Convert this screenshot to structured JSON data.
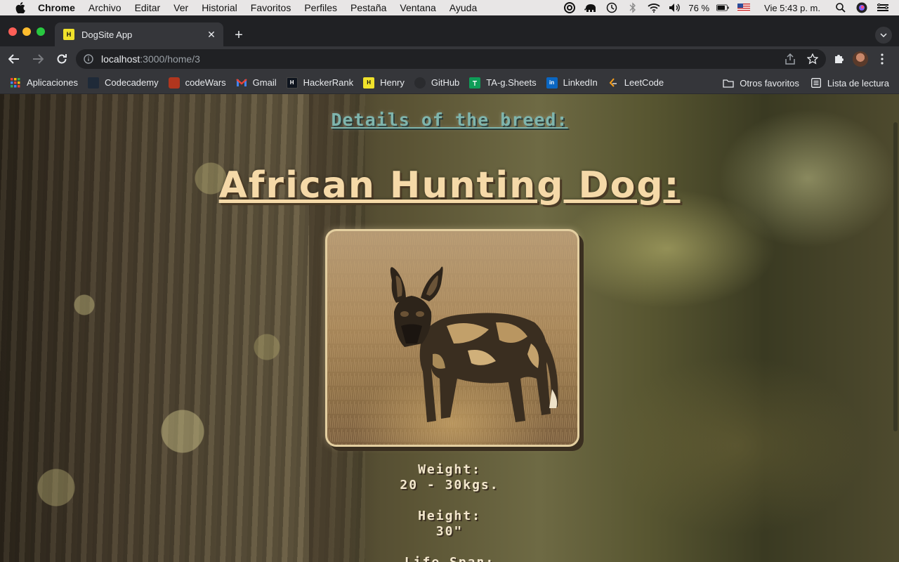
{
  "menubar": {
    "app_name": "Chrome",
    "items": [
      "Archivo",
      "Editar",
      "Ver",
      "Historial",
      "Favoritos",
      "Perfiles",
      "Pestaña",
      "Ventana",
      "Ayuda"
    ],
    "battery": "76 %",
    "clock": "Vie 5:43 p. m."
  },
  "tab": {
    "title": "DogSite App",
    "favicon_text": "H"
  },
  "omnibox": {
    "host": "localhost",
    "path": ":3000/home/3"
  },
  "bookmarks": {
    "items": [
      {
        "label": "Aplicaciones",
        "icon": "apps-grid-icon"
      },
      {
        "label": "Codecademy",
        "icon": "codecademy-icon"
      },
      {
        "label": "codeWars",
        "icon": "codewars-icon"
      },
      {
        "label": "Gmail",
        "icon": "gmail-icon"
      },
      {
        "label": "HackerRank",
        "icon": "hackerrank-icon"
      },
      {
        "label": "Henry",
        "icon": "henry-icon"
      },
      {
        "label": "GitHub",
        "icon": "github-icon"
      },
      {
        "label": "TA-g.Sheets",
        "icon": "sheets-icon"
      },
      {
        "label": "LinkedIn",
        "icon": "linkedin-icon"
      },
      {
        "label": "LeetCode",
        "icon": "leetcode-icon"
      }
    ],
    "other_favorites": "Otros favoritos",
    "reading_list": "Lista de lectura"
  },
  "page": {
    "subheading": "Details of the breed:",
    "breed_name": "African Hunting Dog:",
    "weight_label": "Weight:",
    "weight_value": "20 - 30kgs.",
    "height_label": "Height:",
    "height_value": "30\"",
    "lifespan_label": "Life Span:"
  },
  "colors": {
    "subheading": "#7fb5ad",
    "breed_name": "#f5d9a8",
    "stats_text": "#f3e7cd"
  }
}
